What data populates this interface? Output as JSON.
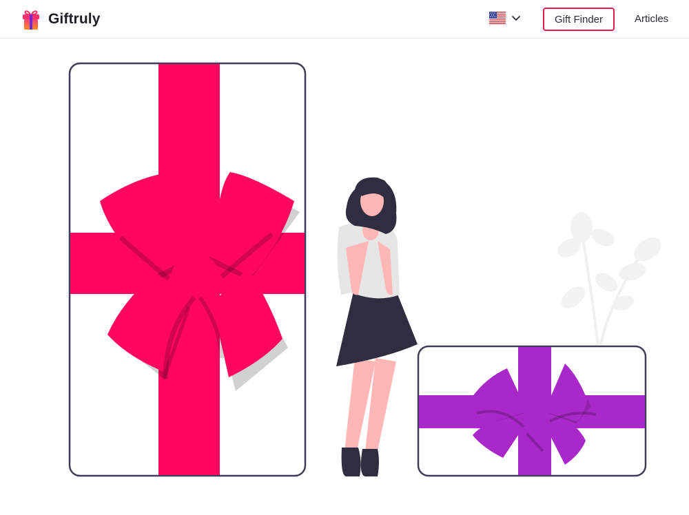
{
  "header": {
    "brand_name": "Giftruly",
    "language": {
      "selected": "English (US)",
      "flag_icon": "us-flag-icon",
      "chevron_icon": "chevron-down-icon"
    },
    "gift_finder_label": "Gift Finder",
    "articles_label": "Articles"
  },
  "hero": {
    "illustration": "woman-with-gift-boxes-illustration"
  },
  "colors": {
    "accent": "#e6194b",
    "ribbon_large": "#ff075e",
    "ribbon_small": "#a828c9",
    "outline": "#3f3d56",
    "text": "#1f1d27"
  }
}
